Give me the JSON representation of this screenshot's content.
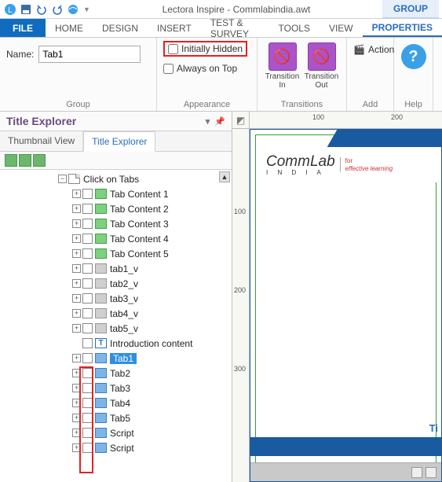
{
  "qat": {
    "app_title": "Lectora Inspire - Commlabindia.awt",
    "context_tab": "GROUP"
  },
  "tabs": {
    "file": "FILE",
    "home": "HOME",
    "design": "DESIGN",
    "insert": "INSERT",
    "test": "TEST & SURVEY",
    "tools": "TOOLS",
    "view": "VIEW",
    "properties": "PROPERTIES"
  },
  "ribbon": {
    "group": {
      "name_label": "Name:",
      "name_value": "Tab1",
      "section": "Group"
    },
    "appearance": {
      "initially_hidden": "Initially Hidden",
      "always_on_top": "Always on Top",
      "section": "Appearance"
    },
    "transitions": {
      "in": "Transition In",
      "out": "Transition Out",
      "section": "Transitions"
    },
    "add": {
      "action": "Action",
      "section": "Add"
    },
    "help": {
      "section": "Help"
    }
  },
  "panel": {
    "title": "Title Explorer",
    "views": {
      "thumb": "Thumbnail View",
      "tree": "Title Explorer"
    }
  },
  "tree": {
    "page": "Click on Tabs",
    "items": [
      {
        "label": "Tab Content 1",
        "icon": "grp"
      },
      {
        "label": "Tab Content 2",
        "icon": "grp"
      },
      {
        "label": "Tab Content 3",
        "icon": "grp"
      },
      {
        "label": "Tab Content 4",
        "icon": "grp"
      },
      {
        "label": "Tab Content 5",
        "icon": "grp"
      },
      {
        "label": "tab1_v",
        "icon": "grp-gray"
      },
      {
        "label": "tab2_v",
        "icon": "grp-gray"
      },
      {
        "label": "tab3_v",
        "icon": "grp-gray"
      },
      {
        "label": "tab4_v",
        "icon": "grp-gray"
      },
      {
        "label": "tab5_v",
        "icon": "grp-gray"
      },
      {
        "label": "Introduction content",
        "icon": "txt"
      },
      {
        "label": "Tab1",
        "icon": "grpx",
        "selected": true
      },
      {
        "label": "Tab2",
        "icon": "grpx"
      },
      {
        "label": "Tab3",
        "icon": "grpx"
      },
      {
        "label": "Tab4",
        "icon": "grpx"
      },
      {
        "label": "Tab5",
        "icon": "grpx"
      },
      {
        "label": "Script",
        "icon": "grpx"
      },
      {
        "label": "Script",
        "icon": "grpx"
      }
    ]
  },
  "canvas": {
    "h_ticks": [
      "100",
      "200"
    ],
    "v_ticks": [
      "100",
      "200",
      "300"
    ],
    "logo_main": "CommLab",
    "logo_sub": "I  N  D  I  A",
    "logo_tag1": "for",
    "logo_tag2": "effective learning",
    "footer_ti": "Ti"
  }
}
